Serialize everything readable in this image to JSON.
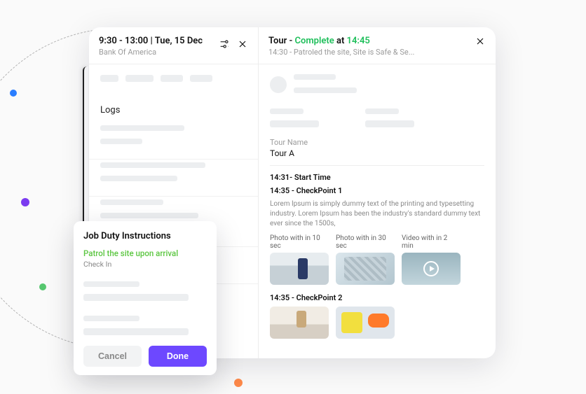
{
  "left": {
    "time_range": "9:30 - 13:00",
    "date_sep": "  |  ",
    "date": "Tue, 15 Dec",
    "subtitle": "Bank Of America",
    "logs_heading": "Logs"
  },
  "right": {
    "title_prefix": "Tour - ",
    "status_word": "Complete",
    "at_word": " at ",
    "status_time": "14:45",
    "subtitle": "14:30 - Patroled the site, Site is Safe & Se...",
    "tour_name_label": "Tour Name",
    "tour_name_value": "Tour A",
    "line_start": "14:31- Start Time",
    "cp1_line": "14:35 - CheckPoint 1",
    "cp1_desc": "Lorem Ipsum is simply dummy text of the printing and typesetting industry. Lorem Ipsum has been the industry's standard dummy text ever since the 1500s,",
    "media_caps": {
      "c1": "Photo with in 10 sec",
      "c2": "Photo with in 30 sec",
      "c3": "Video with in 2 min"
    },
    "cp2_line": "14:35 - CheckPoint 2"
  },
  "modal": {
    "title": "Job Duty Instructions",
    "highlight": "Patrol the site upon arrival",
    "sub": "Check In",
    "cancel": "Cancel",
    "done": "Done"
  }
}
